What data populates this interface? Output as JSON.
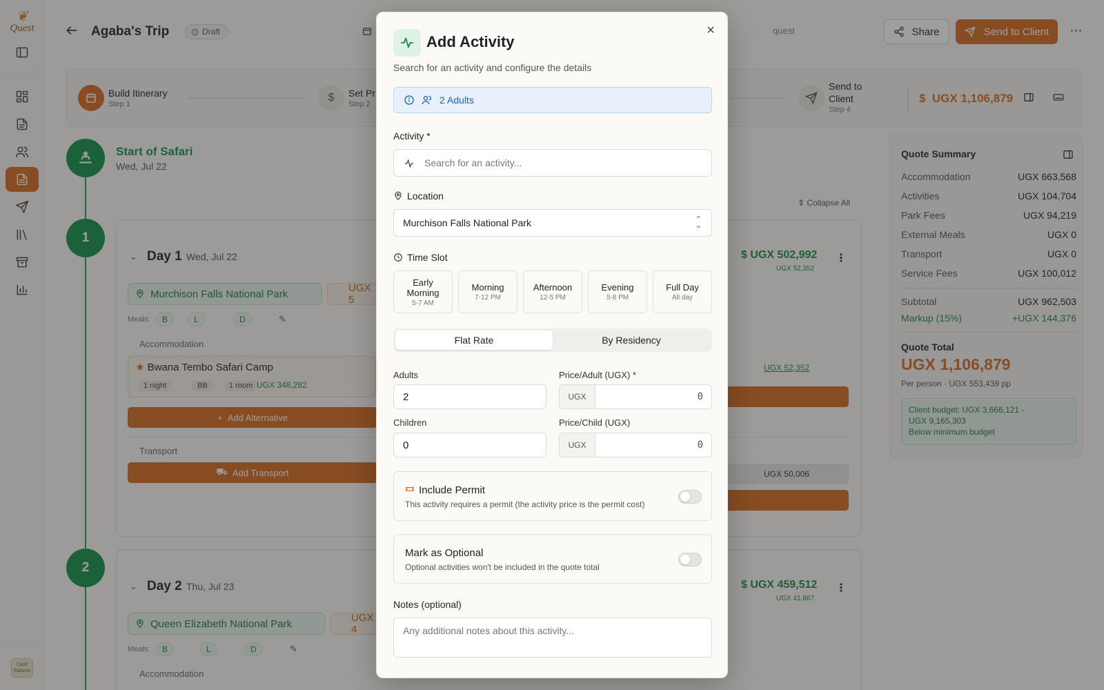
{
  "sidebar": {
    "logo_text": "Quest",
    "avatar_text": "Cant Safaris",
    "items": [
      {
        "icon": "sidebar-toggle-icon"
      },
      {
        "icon": "dashboard-icon"
      },
      {
        "icon": "document-icon"
      },
      {
        "icon": "users-icon"
      },
      {
        "icon": "quotes-icon",
        "active": true
      },
      {
        "icon": "send-icon"
      },
      {
        "icon": "library-icon"
      },
      {
        "icon": "archive-icon"
      },
      {
        "icon": "chart-icon"
      }
    ]
  },
  "header": {
    "title": "Agaba's Trip",
    "status": "Draft",
    "quest_fragment": "quest",
    "share_label": "Share",
    "send_label": "Send to Client",
    "more_label": "⋯"
  },
  "steps": {
    "items": [
      {
        "title": "Build Itinerary",
        "sub": "Step 1"
      },
      {
        "title": "Set Pr",
        "sub": "Step 2"
      },
      {
        "title": "Send to",
        "title2": "Client",
        "sub": "Step 4"
      }
    ],
    "total": "UGX 1,106,879"
  },
  "timeline": {
    "start_title": "Start of Safari",
    "start_date": "Wed, Jul 22",
    "collapse_label": "Collapse All",
    "days": [
      {
        "number": "1",
        "title": "Day 1",
        "date": "Wed, Jul 22",
        "location": "Murchison Falls National Park",
        "fee_fragment": "UGX 5",
        "price": "UGX 502,992",
        "sub_price": "UGX 52,352",
        "meals_label": "Meals:",
        "meals": [
          "B",
          "L",
          "D"
        ],
        "accommodation_label": "Accommodation",
        "camp_name": "Bwana Tembo Safari Camp",
        "nights": "1 night",
        "board": "BB",
        "rooms": "1 room",
        "acc_price": "UGX 348,282",
        "add_alternative": "Add Alternative",
        "transport_label": "Transport",
        "add_transport": "Add Transport",
        "link_price": "UGX 52,352",
        "transport_price": "UGX 50,006"
      },
      {
        "number": "2",
        "title": "Day 2",
        "date": "Thu, Jul 23",
        "location": "Queen Elizabeth National Park",
        "fee_fragment": "UGX 4",
        "price": "UGX 459,512",
        "sub_price": "UGX 41,867",
        "meals_label": "Meals:",
        "meals": [
          "B",
          "L",
          "D"
        ],
        "accommodation_label": "Accommodation"
      }
    ]
  },
  "quote_summary": {
    "title": "Quote Summary",
    "rows": [
      {
        "label": "Accommodation",
        "value": "UGX 663,568"
      },
      {
        "label": "Activities",
        "value": "UGX 104,704"
      },
      {
        "label": "Park Fees",
        "value": "UGX 94,219"
      },
      {
        "label": "External Meals",
        "value": "UGX 0"
      },
      {
        "label": "Transport",
        "value": "UGX 0"
      },
      {
        "label": "Service Fees",
        "value": "UGX 100,012"
      }
    ],
    "subtotal": {
      "label": "Subtotal",
      "value": "UGX 962,503"
    },
    "markup": {
      "label": "Markup (15%)",
      "value": "+UGX 144,376"
    },
    "total_label": "Quote Total",
    "total_value": "UGX 1,106,879",
    "per_person": "Per person · UGX 553,439 pp",
    "budget_line1": "Client budget: UGX 3,666,121 -",
    "budget_line2": "UGX 9,165,303",
    "budget_note": "Below minimum budget"
  },
  "modal": {
    "title": "Add Activity",
    "subtitle": "Search for an activity and configure the details",
    "guests": "2 Adults",
    "activity_label": "Activity *",
    "activity_placeholder": "Search for an activity...",
    "location_label": "Location",
    "location_value": "Murchison Falls National Park",
    "time_slot_label": "Time Slot",
    "slots": [
      {
        "name": "Early",
        "name2": "Morning",
        "time": "5-7 AM"
      },
      {
        "name": "Morning",
        "time": "7-12 PM"
      },
      {
        "name": "Afternoon",
        "time": "12-5 PM"
      },
      {
        "name": "Evening",
        "time": "5-8 PM"
      },
      {
        "name": "Full Day",
        "time": "All day"
      }
    ],
    "rate_tabs": [
      "Flat Rate",
      "By Residency"
    ],
    "selected_rate": "Flat Rate",
    "adults_label": "Adults",
    "adults_value": "2",
    "price_adult_label": "Price/Adult (UGX) *",
    "currency": "UGX",
    "price_adult_value": "0",
    "children_label": "Children",
    "children_value": "0",
    "price_child_label": "Price/Child (UGX)",
    "price_child_value": "0",
    "permit_title": "Include Permit",
    "permit_desc": "This activity requires a permit (the activity price is the permit cost)",
    "permit_on": false,
    "optional_title": "Mark as Optional",
    "optional_desc": "Optional activities won't be included in the quote total",
    "optional_on": false,
    "notes_label": "Notes (optional)",
    "notes_placeholder": "Any additional notes about this activity...",
    "close_label": "×"
  }
}
